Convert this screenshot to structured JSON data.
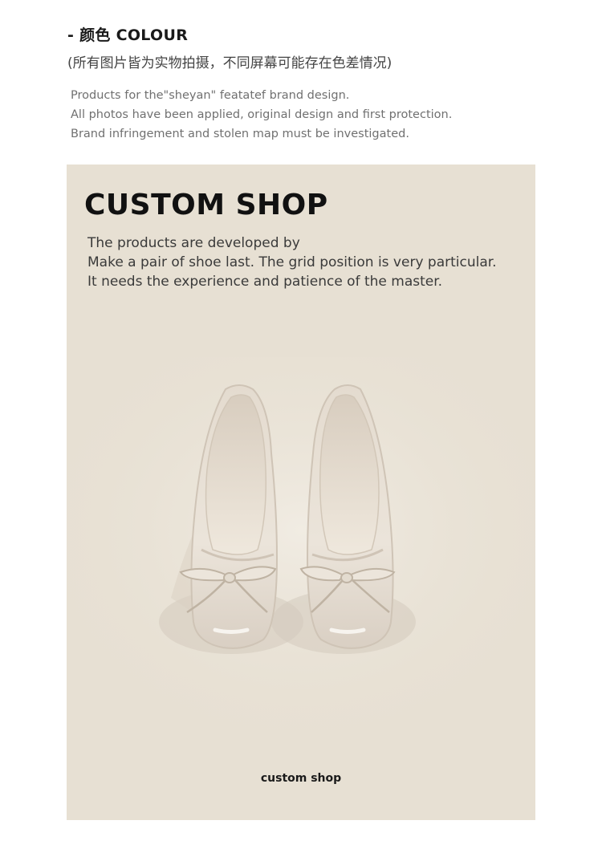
{
  "colour_section": {
    "heading": "- 颜色 COLOUR",
    "note": "(所有图片皆为实物拍摄，不同屏幕可能存在色差情况)"
  },
  "brand_notice": {
    "lines": [
      "Products for the\"sheyan\" featatef brand design.",
      "All photos have been applied, original design and first protection.",
      "Brand infringement and stolen map must be investigated."
    ]
  },
  "custom_shop": {
    "title": "CUSTOM SHOP",
    "lines": [
      "The products are developed by",
      "Make a pair of shoe last. The grid position is very particular.",
      "It needs the experience and patience of the master."
    ],
    "caption": "custom shop",
    "background_color": "#e7e0d3",
    "shoe_color": "#e9e2d8"
  }
}
